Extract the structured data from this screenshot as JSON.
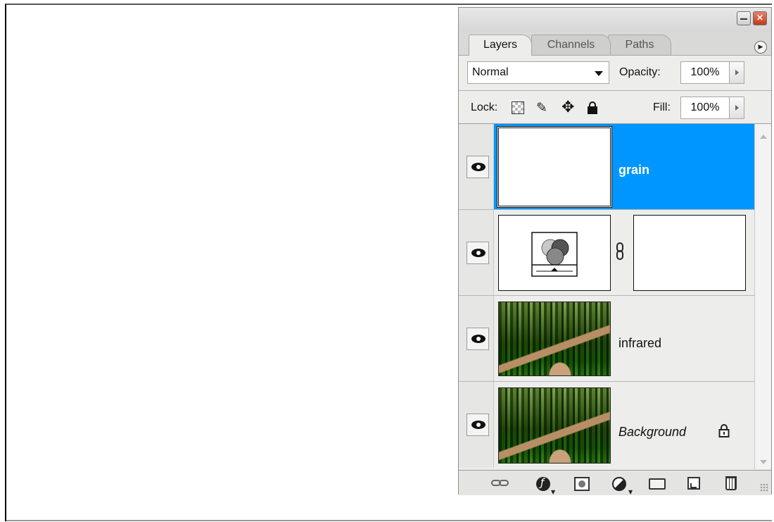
{
  "panel": {
    "tabs": [
      "Layers",
      "Channels",
      "Paths"
    ],
    "active_tab": "Layers",
    "blend_mode": "Normal",
    "opacity_label": "Opacity:",
    "opacity_value": "100%",
    "lock_label": "Lock:",
    "fill_label": "Fill:",
    "fill_value": "100%",
    "layers": [
      {
        "name": "grain",
        "selected": true,
        "visible": true,
        "type": "pixel"
      },
      {
        "name": "",
        "selected": false,
        "visible": true,
        "type": "adjustment-with-mask"
      },
      {
        "name": "infrared",
        "selected": false,
        "visible": true,
        "type": "pixel"
      },
      {
        "name": "Background",
        "selected": false,
        "visible": true,
        "type": "background",
        "locked": true
      }
    ],
    "colors": {
      "selection": "#0096ff",
      "panel_bg": "#ededeb"
    }
  }
}
